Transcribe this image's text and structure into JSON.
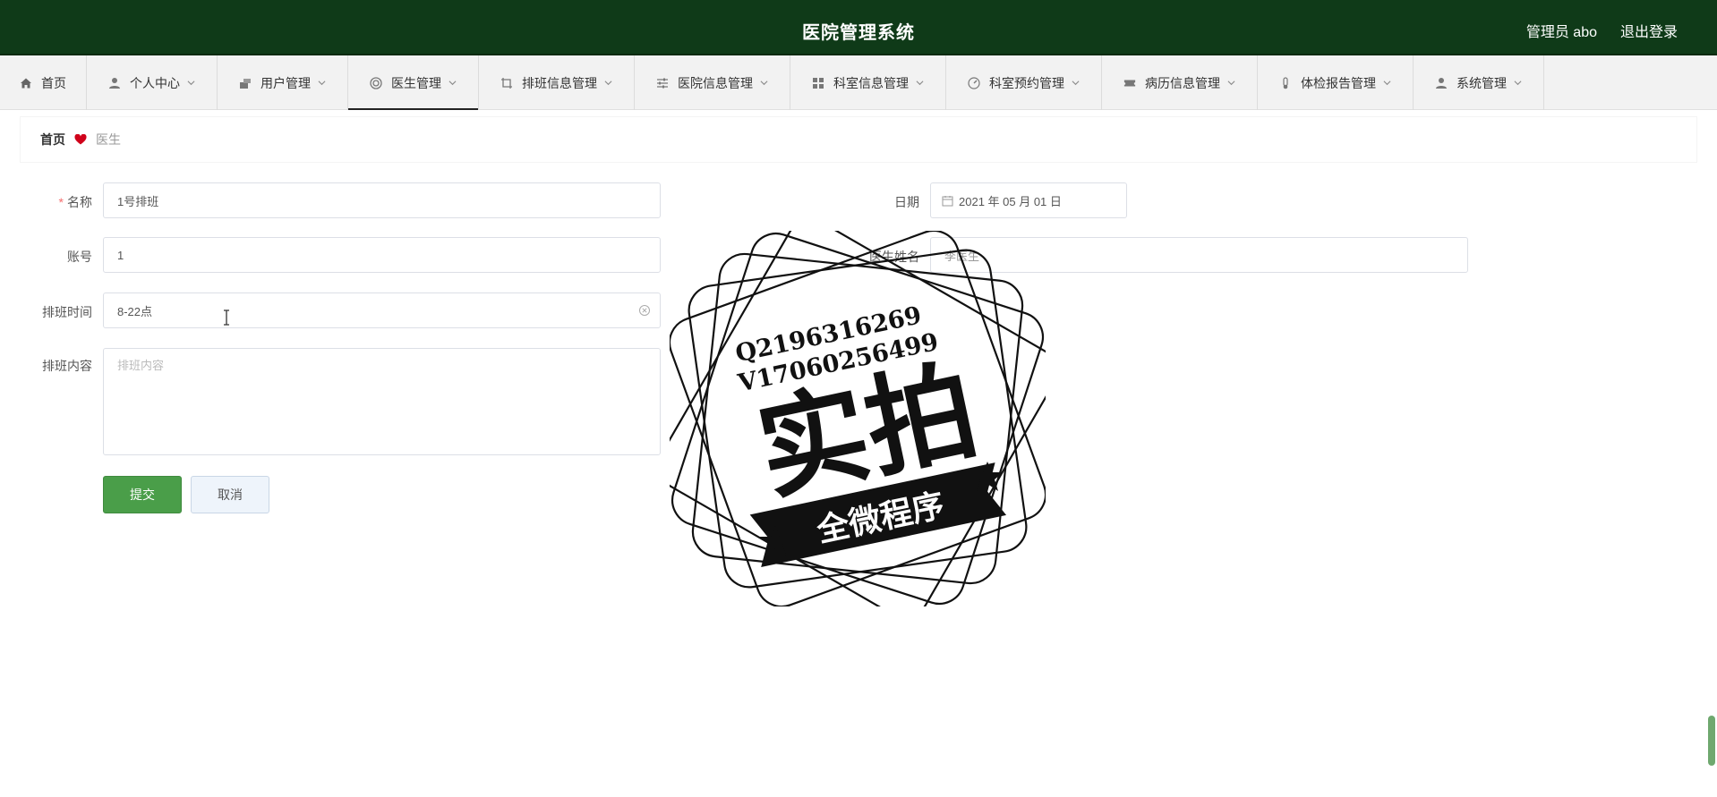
{
  "header": {
    "title": "医院管理系统",
    "user": "管理员 abo",
    "logout": "退出登录"
  },
  "nav": [
    {
      "label": "首页",
      "icon": "home-icon",
      "has_menu": false
    },
    {
      "label": "个人中心",
      "icon": "person-icon",
      "has_menu": true
    },
    {
      "label": "用户管理",
      "icon": "users-icon",
      "has_menu": true
    },
    {
      "label": "医生管理",
      "icon": "doctor-icon",
      "has_menu": true,
      "active": true
    },
    {
      "label": "排班信息管理",
      "icon": "crop-icon",
      "has_menu": true
    },
    {
      "label": "医院信息管理",
      "icon": "sliders-icon",
      "has_menu": true
    },
    {
      "label": "科室信息管理",
      "icon": "grid-icon",
      "has_menu": true
    },
    {
      "label": "科室预约管理",
      "icon": "gauge-icon",
      "has_menu": true
    },
    {
      "label": "病历信息管理",
      "icon": "ticket-icon",
      "has_menu": true
    },
    {
      "label": "体检报告管理",
      "icon": "thermometer-icon",
      "has_menu": true
    },
    {
      "label": "系统管理",
      "icon": "person-icon",
      "has_menu": true
    }
  ],
  "breadcrumb": {
    "home": "首页",
    "current": "医生"
  },
  "form": {
    "name_label": "名称",
    "name_value": "1号排班",
    "account_label": "账号",
    "account_value": "1",
    "time_label": "排班时间",
    "time_value": "8-22点",
    "content_label": "排班内容",
    "content_placeholder": "排班内容",
    "date_label": "日期",
    "date_value": "2021 年 05 月 01 日",
    "doctor_label": "医生姓名",
    "doctor_value": "李医生",
    "submit": "提交",
    "cancel": "取消"
  },
  "watermark": {
    "line1": "Q2196316269",
    "line2": "V17060256499",
    "main": "实拍",
    "ribbon": "全微程序"
  },
  "colors": {
    "header_bg": "#0f3a18",
    "primary": "#4a9e49",
    "heart": "#d0021b"
  }
}
